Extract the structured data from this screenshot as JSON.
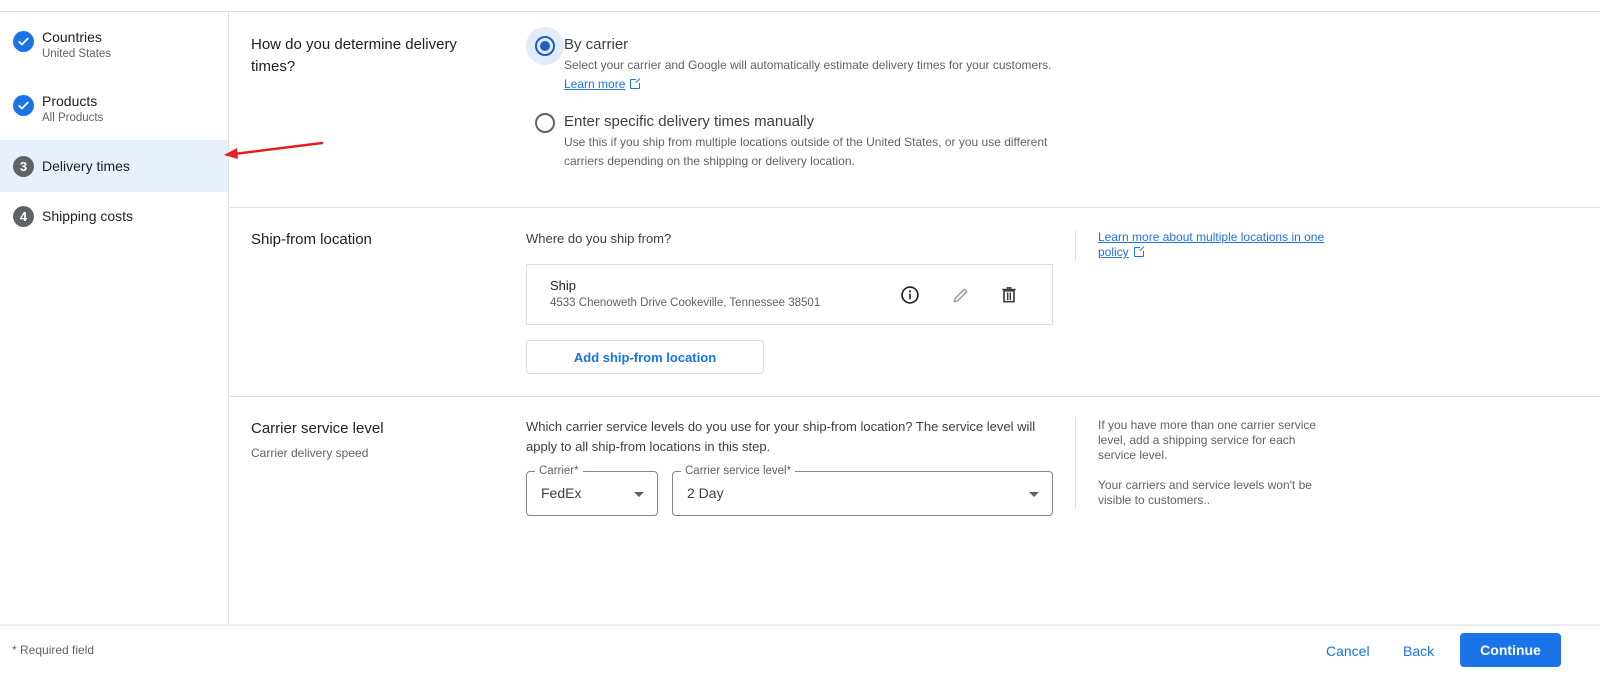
{
  "sidebar": {
    "steps": [
      {
        "label": "Countries",
        "sub": "United States",
        "status": "done",
        "icon": "check-icon"
      },
      {
        "label": "Products",
        "sub": "All Products",
        "status": "done",
        "icon": "check-icon"
      },
      {
        "label": "Delivery times",
        "number": "3",
        "status": "active"
      },
      {
        "label": "Shipping costs",
        "number": "4",
        "status": "pending"
      }
    ]
  },
  "delivery_method": {
    "title": "How do you determine delivery times?",
    "options": [
      {
        "label": "By carrier",
        "description": "Select your carrier and Google will automatically estimate delivery times for your customers.",
        "link": "Learn more",
        "selected": true
      },
      {
        "label": "Enter specific delivery times manually",
        "description": "Use this if you ship from multiple locations outside of the United States, or you use different carriers depending on the shipping or delivery location.",
        "selected": false
      }
    ]
  },
  "ship_from": {
    "title": "Ship-from location",
    "question": "Where do you ship from?",
    "location": {
      "name": "Ship",
      "address": "4533 Chenoweth Drive Cookeville, Tennessee 38501"
    },
    "add_button": "Add ship-from location",
    "side_link": "Learn more about multiple locations in one policy"
  },
  "carrier_service": {
    "title": "Carrier service level",
    "subtitle": "Carrier delivery speed",
    "question": "Which carrier service levels do you use for your ship-from location? The service level will apply to all ship-from locations in this step.",
    "carrier_label": "Carrier*",
    "carrier_value": "FedEx",
    "level_label": "Carrier service level*",
    "level_value": "2 Day",
    "note1": "If you have more than one carrier service level, add a shipping service for each service level.",
    "note2": "Your carriers and service levels won't be visible to customers.."
  },
  "footer": {
    "required_note": "* Required field",
    "cancel": "Cancel",
    "back": "Back",
    "continue": "Continue"
  },
  "colors": {
    "accent": "#1a73e8",
    "annotation": "#e02020"
  }
}
